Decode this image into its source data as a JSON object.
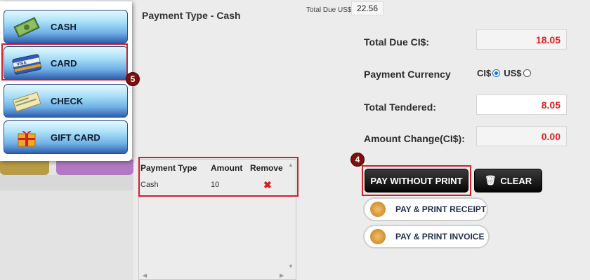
{
  "payment_methods": [
    {
      "label": "CASH",
      "icon": "cash-icon"
    },
    {
      "label": "CARD",
      "icon": "card-icon",
      "card_brand": "VISA"
    },
    {
      "label": "CHECK",
      "icon": "check-icon"
    },
    {
      "label": "GIFT CARD",
      "icon": "gift-card-icon"
    }
  ],
  "badges": {
    "card": "5",
    "pay": "4"
  },
  "payment_type_title": "Payment Type - Cash",
  "total_due_usd": {
    "label": "Total Due US$",
    "value": "22.56"
  },
  "summary": {
    "total_due_ci": {
      "label": "Total Due CI$:",
      "value": "18.05"
    },
    "payment_currency": {
      "label": "Payment Currency",
      "options": [
        "CI$",
        "US$"
      ],
      "selected": "CI$"
    },
    "total_tendered": {
      "label": "Total Tendered:",
      "value": "8.05"
    },
    "amount_change": {
      "label": "Amount Change(CI$):",
      "value": "0.00"
    }
  },
  "payments_table": {
    "headers": [
      "Payment Type",
      "Amount",
      "Remove"
    ],
    "rows": [
      {
        "type": "Cash",
        "amount": "10",
        "remove": "✖"
      }
    ]
  },
  "actions": {
    "pay_without_print": "PAY WITHOUT PRINT",
    "clear": "CLEAR",
    "pay_print_receipt": "PAY & PRINT RECEIPT",
    "pay_print_invoice": "PAY & PRINT INVOICE"
  },
  "colors": {
    "accent_red": "#d0202a",
    "value_red": "#e02020",
    "badge": "#7a1010"
  }
}
